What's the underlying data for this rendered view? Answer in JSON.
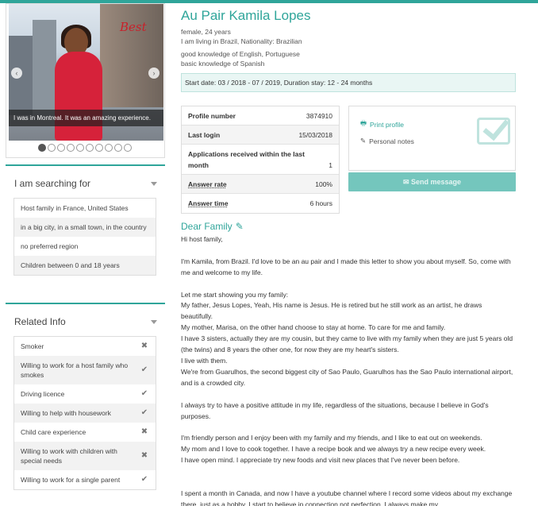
{
  "photo": {
    "caption": "I was in Montreal. It was an amazing experience.",
    "sign_text": "Best",
    "dot_count": 10,
    "active_dot": 0
  },
  "searching": {
    "title": "I am searching for",
    "items": [
      "Host family in France, United States",
      "in a big city, in a small town, in the country",
      "no preferred region",
      "Children between 0 and 18 years"
    ]
  },
  "related": {
    "title": "Related Info",
    "items": [
      {
        "label": "Smoker",
        "value": "no"
      },
      {
        "label": "Willing to work for a host family who smokes",
        "value": "yes"
      },
      {
        "label": "Driving licence",
        "value": "yes"
      },
      {
        "label": "Willing to help with housework",
        "value": "yes"
      },
      {
        "label": "Child care experience",
        "value": "no"
      },
      {
        "label": "Willing to work with children with special needs",
        "value": "no"
      },
      {
        "label": "Willing to work for a single parent",
        "value": "yes"
      }
    ]
  },
  "profile": {
    "name": "Au Pair Kamila Lopes",
    "gender_age": "female, 24 years",
    "living": "I am living in Brazil, Nationality: Brazilian",
    "lang1": "good knowledge of English, Portuguese",
    "lang2": "basic knowledge of Spanish",
    "dates": "Start date: 03 / 2018 - 07 / 2019, Duration stay: 12 - 24 months"
  },
  "stats": [
    {
      "label": "Profile number",
      "value": "3874910"
    },
    {
      "label": "Last login",
      "value": "15/03/2018"
    },
    {
      "label": "Applications received within the last month",
      "value": "1"
    },
    {
      "label": "Answer rate",
      "value": "100%"
    },
    {
      "label": "Answer time",
      "value": "6 hours"
    }
  ],
  "actions": {
    "print": "Print profile",
    "notes": "Personal notes",
    "send": "Send message"
  },
  "letter": {
    "title": "Dear Family",
    "text": "Hi host family,\n\nI'm Kamila, from Brazil. I'd love to be an au pair and I made this letter to show you about myself. So, come with me and welcome to my life.\n\nLet me start showing you my family:\nMy father, Jesus Lopes, Yeah, His name is Jesus. He is retired but he still work as an artist, he draws beautifully.\nMy mother, Marisa, on the other hand choose to stay at home. To care for me and family.\nI have 3 sisters, actually they are my cousin, but they came to live with my family when they are just 5 years old (the twins) and 8 years the other one, for now they are my heart's sisters.\nI live with them.\nWe're from Guarulhos, the second biggest city of Sao Paulo, Guarulhos has the Sao Paulo international airport, and is a crowded city.\n\nI always try to have a positive attitude in my life, regardless of the situations, because I believe in God's purposes.\n\nI'm friendly person and I enjoy been with my family and my friends, and I like to eat out on weekends.\nMy mom and I love to cook together. I have a recipe book and we always try a new recipe every week.\nI have open mind. I appreciate try new foods and visit new places that I've never been before.\n\n\nI spent a month in Canada, and now I have a youtube channel where I record some videos about my exchange there, just as a hobby. I start to believe in connection not perfection. I always make my"
  }
}
